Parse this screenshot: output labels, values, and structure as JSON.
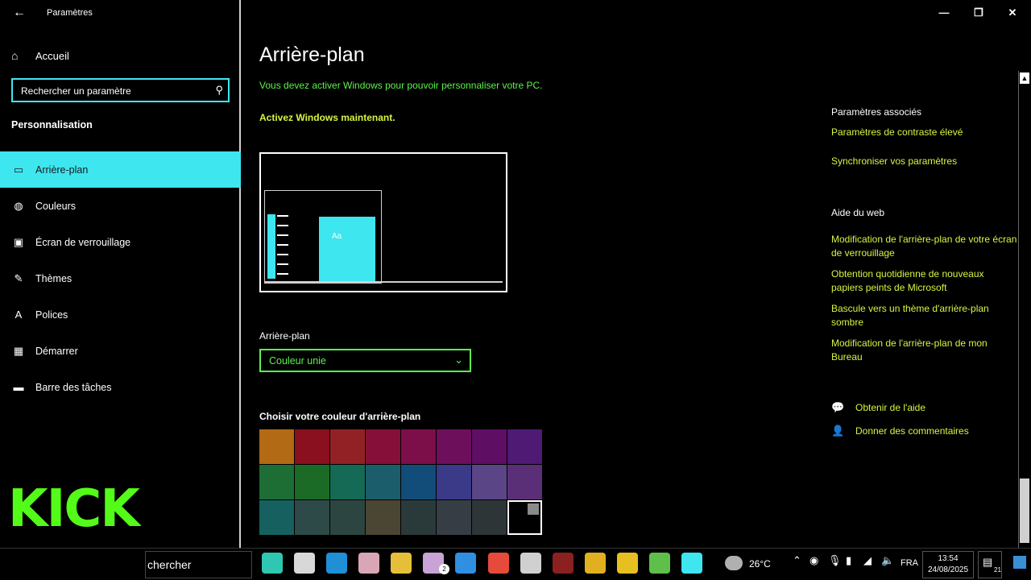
{
  "window": {
    "title": "Paramètres",
    "back_glyph": "←",
    "minimize": "—",
    "maximize": "❐",
    "close": "✕"
  },
  "sidebar": {
    "home_label": "Accueil",
    "search_value": "Rechercher un paramètre",
    "section_title": "Personnalisation",
    "items": [
      {
        "label": "Arrière-plan",
        "icon": "image-icon",
        "glyph": "▭",
        "active": true
      },
      {
        "label": "Couleurs",
        "icon": "palette-icon",
        "glyph": "◍",
        "active": false
      },
      {
        "label": "Écran de verrouillage",
        "icon": "lock-screen-icon",
        "glyph": "▣",
        "active": false
      },
      {
        "label": "Thèmes",
        "icon": "brush-icon",
        "glyph": "✎",
        "active": false
      },
      {
        "label": "Polices",
        "icon": "font-icon",
        "glyph": "A",
        "active": false
      },
      {
        "label": "Démarrer",
        "icon": "start-icon",
        "glyph": "▦",
        "active": false
      },
      {
        "label": "Barre des tâches",
        "icon": "taskbar-icon",
        "glyph": "▬",
        "active": false
      }
    ],
    "logo_text": "KICK"
  },
  "main": {
    "title": "Arrière-plan",
    "warning": "Vous devez activer Windows pour pouvoir personnaliser votre PC.",
    "activate_link": "Activez Windows maintenant.",
    "preview_tile_text": "Aa",
    "background_label": "Arrière-plan",
    "background_value": "Couleur unie",
    "color_label": "Choisir votre couleur d'arrière-plan",
    "swatches": [
      "#b36a14",
      "#8a0f1f",
      "#922126",
      "#860f3a",
      "#7c0f49",
      "#6d0f5b",
      "#5e0f64",
      "#4e1a74",
      "#1c6e35",
      "#1b6a26",
      "#146a55",
      "#1b5d6b",
      "#124c78",
      "#3a3a88",
      "#5a4686",
      "#5b2f78",
      "#16615f",
      "#2d4a48",
      "#2d4540",
      "#4b4534",
      "#2a3a3a",
      "#363d45",
      "#2d3537",
      "#000000"
    ],
    "selected_swatch": 23
  },
  "right": {
    "related_head": "Paramètres associés",
    "related_links": [
      "Paramètres de contraste élevé",
      "Synchroniser vos paramètres"
    ],
    "web_head": "Aide du web",
    "web_links": [
      "Modification de l'arrière-plan de votre écran de verrouillage",
      "Obtention quotidienne de nouveaux papiers peints de Microsoft",
      "Bascule vers un thème d'arrière-plan sombre",
      "Modification de l'arrière-plan de mon Bureau"
    ],
    "help_label": "Obtenir de l'aide",
    "feedback_label": "Donner des commentaires"
  },
  "taskbar": {
    "search_text": "chercher",
    "apps": [
      {
        "name": "taskview-app",
        "color": "#2fc6b2"
      },
      {
        "name": "notepad-app",
        "color": "#d8d8d8"
      },
      {
        "name": "edge-app",
        "color": "#1f8fd6"
      },
      {
        "name": "mail-app",
        "color": "#d9a6b6"
      },
      {
        "name": "explorer-app",
        "color": "#e6bf3a"
      },
      {
        "name": "photos-app",
        "color": "#c9a2d6"
      },
      {
        "name": "facebook-app",
        "color": "#2f8fe0"
      },
      {
        "name": "chrome-app",
        "color": "#e64a3a"
      },
      {
        "name": "store-app",
        "color": "#d0d0d0"
      },
      {
        "name": "recorder-app",
        "color": "#8a2020"
      },
      {
        "name": "yellow-app",
        "color": "#e0b020"
      },
      {
        "name": "chat-app",
        "color": "#e6c020"
      },
      {
        "name": "bluestacks-app",
        "color": "#5fbf4a"
      },
      {
        "name": "settings-app",
        "color": "#3ee6f0"
      }
    ],
    "photos_badge": "2",
    "temperature": "26°C",
    "language": "FRA",
    "time": "13:54",
    "date": "24/08/2025",
    "notif_count": "21"
  }
}
